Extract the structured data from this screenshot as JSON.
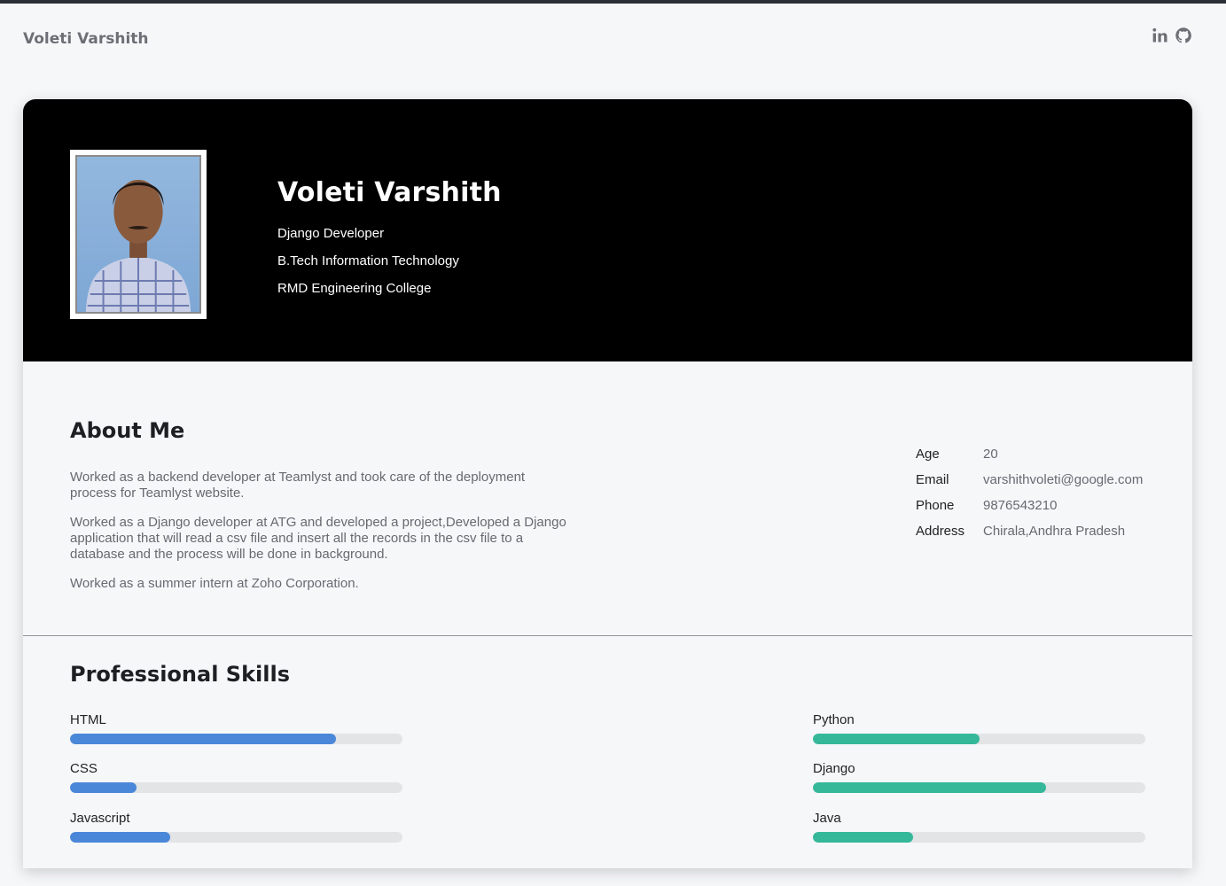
{
  "navbar": {
    "brand": "Voleti Varshith",
    "social": [
      {
        "icon": "linkedin-icon"
      },
      {
        "icon": "github-icon"
      }
    ]
  },
  "hero": {
    "name": "Voleti Varshith",
    "role": "Django Developer",
    "degree": "B.Tech Information Technology",
    "college": "RMD Engineering College"
  },
  "about": {
    "title": "About Me",
    "paragraphs": [
      "Worked as a backend developer at Teamlyst and took care of the deployment process for Teamlyst website.",
      "Worked as a Django developer at ATG and developed a project,Developed a Django application that will read a csv file and insert all the records in the csv file to a database and the process will be done in background.",
      "Worked as a summer intern at Zoho Corporation."
    ],
    "info": [
      {
        "label": "Age",
        "value": "20"
      },
      {
        "label": "Email",
        "value": "varshithvoleti@google.com"
      },
      {
        "label": "Phone",
        "value": "9876543210"
      },
      {
        "label": "Address",
        "value": "Chirala,Andhra Pradesh"
      }
    ]
  },
  "skills": {
    "title": "Professional Skills",
    "left": [
      {
        "label": "HTML",
        "level": 0.8
      },
      {
        "label": "CSS",
        "level": 0.2
      },
      {
        "label": "Javascript",
        "level": 0.3
      }
    ],
    "right": [
      {
        "label": "Python",
        "level": 0.5
      },
      {
        "label": "Django",
        "level": 0.7
      },
      {
        "label": "Java",
        "level": 0.3
      }
    ],
    "colors": {
      "left": "#4a87d9",
      "right": "#35b899"
    }
  }
}
